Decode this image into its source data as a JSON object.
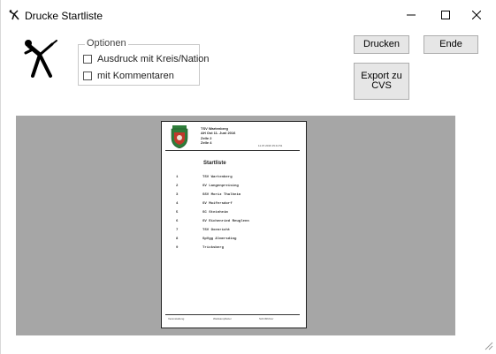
{
  "window": {
    "title": "Drucke Startliste"
  },
  "options": {
    "legend": "Optionen",
    "checkbox_region": "Ausdruck mit Kreis/Nation",
    "checkbox_comments": "mit Kommentaren"
  },
  "buttons": {
    "print": "Drucken",
    "end": "Ende",
    "export": "Export zu\nCVS"
  },
  "preview": {
    "header_lines": [
      "TSV Wartenberg",
      "AH Ost 11. Juni 2016",
      "Zelle 2",
      "Zelle 4"
    ],
    "date": "11.07.2016 15:41:51",
    "title": "Startliste",
    "entries": [
      {
        "num": "1",
        "name": "TSV Wartenberg"
      },
      {
        "num": "2",
        "name": "SV Langenpreising"
      },
      {
        "num": "3",
        "name": "SSV Moriz Thalheim"
      },
      {
        "num": "4",
        "name": "SV Moifersdorf"
      },
      {
        "num": "5",
        "name": "SC Steinheim"
      },
      {
        "num": "6",
        "name": "SV Eichenried Reuglenn"
      },
      {
        "num": "7",
        "name": "TSV Oxenricht"
      },
      {
        "num": "8",
        "name": "SpVgg Almersding"
      },
      {
        "num": "9",
        "name": "Tricksberg"
      }
    ],
    "footer": [
      "Veranstaltung",
      "Wettkampfleiter",
      "Schriftführer"
    ]
  },
  "colors": {
    "preview_bg": "#a6a6a6",
    "button_bg": "#e6e6e6",
    "crest_green": "#2e7d3a",
    "crest_red": "#c0392b"
  }
}
